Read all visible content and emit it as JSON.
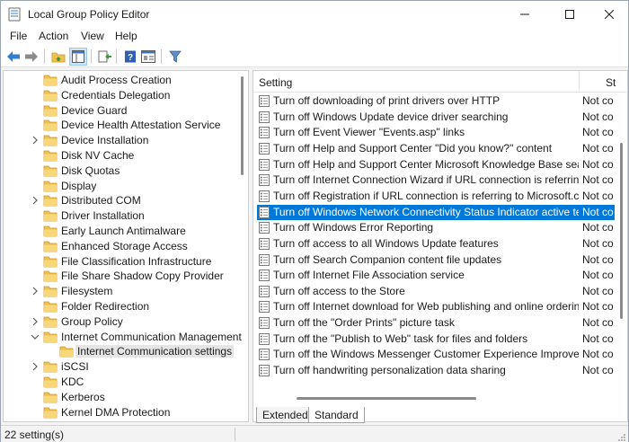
{
  "window": {
    "title": "Local Group Policy Editor"
  },
  "menu": [
    "File",
    "Action",
    "View",
    "Help"
  ],
  "toolbar": {
    "buttons": [
      "back-icon",
      "forward-icon",
      "up-folder-icon",
      "show-hide-tree-icon",
      "export-list-icon",
      "help-icon",
      "properties-icon",
      "filter-icon"
    ]
  },
  "tree": {
    "items": [
      {
        "label": "Audit Process Creation",
        "expandable": false
      },
      {
        "label": "Credentials Delegation",
        "expandable": false
      },
      {
        "label": "Device Guard",
        "expandable": false
      },
      {
        "label": "Device Health Attestation Service",
        "expandable": false
      },
      {
        "label": "Device Installation",
        "expandable": true
      },
      {
        "label": "Disk NV Cache",
        "expandable": false
      },
      {
        "label": "Disk Quotas",
        "expandable": false
      },
      {
        "label": "Display",
        "expandable": false
      },
      {
        "label": "Distributed COM",
        "expandable": true
      },
      {
        "label": "Driver Installation",
        "expandable": false
      },
      {
        "label": "Early Launch Antimalware",
        "expandable": false
      },
      {
        "label": "Enhanced Storage Access",
        "expandable": false
      },
      {
        "label": "File Classification Infrastructure",
        "expandable": false
      },
      {
        "label": "File Share Shadow Copy Provider",
        "expandable": false
      },
      {
        "label": "Filesystem",
        "expandable": true
      },
      {
        "label": "Folder Redirection",
        "expandable": false
      },
      {
        "label": "Group Policy",
        "expandable": true
      },
      {
        "label": "Internet Communication Management",
        "expandable": true,
        "expanded": true
      },
      {
        "label": "Internet Communication settings",
        "expandable": false,
        "child": true,
        "selected": true
      },
      {
        "label": "iSCSI",
        "expandable": true
      },
      {
        "label": "KDC",
        "expandable": false
      },
      {
        "label": "Kerberos",
        "expandable": false
      },
      {
        "label": "Kernel DMA Protection",
        "expandable": false
      }
    ]
  },
  "list": {
    "header": {
      "setting": "Setting",
      "state": "St"
    },
    "rows": [
      {
        "name": "Turn off downloading of print drivers over HTTP",
        "state": "Not co"
      },
      {
        "name": "Turn off Windows Update device driver searching",
        "state": "Not co"
      },
      {
        "name": "Turn off Event Viewer \"Events.asp\" links",
        "state": "Not co"
      },
      {
        "name": "Turn off Help and Support Center \"Did you know?\" content",
        "state": "Not co"
      },
      {
        "name": "Turn off Help and Support Center Microsoft Knowledge Base search",
        "state": "Not co"
      },
      {
        "name": "Turn off Internet Connection Wizard if URL connection is referring ...",
        "state": "Not co"
      },
      {
        "name": "Turn off Registration if URL connection is referring to Microsoft.com",
        "state": "Not co"
      },
      {
        "name": "Turn off Windows Network Connectivity Status Indicator active tests",
        "state": "Not co",
        "selected": true
      },
      {
        "name": "Turn off Windows Error Reporting",
        "state": "Not co"
      },
      {
        "name": "Turn off access to all Windows Update features",
        "state": "Not co"
      },
      {
        "name": "Turn off Search Companion content file updates",
        "state": "Not co"
      },
      {
        "name": "Turn off Internet File Association service",
        "state": "Not co"
      },
      {
        "name": "Turn off access to the Store",
        "state": "Not co"
      },
      {
        "name": "Turn off Internet download for Web publishing and online orderin...",
        "state": "Not co"
      },
      {
        "name": "Turn off the \"Order Prints\" picture task",
        "state": "Not co"
      },
      {
        "name": "Turn off the \"Publish to Web\" task for files and folders",
        "state": "Not co"
      },
      {
        "name": "Turn off the Windows Messenger Customer Experience Improvem...",
        "state": "Not co"
      },
      {
        "name": "Turn off handwriting personalization data sharing",
        "state": "Not co"
      }
    ]
  },
  "tabs": [
    "Extended",
    "Standard"
  ],
  "status": {
    "text": "22 setting(s)"
  },
  "colors": {
    "selection": "#0078d7",
    "folder": "#f0c050"
  }
}
